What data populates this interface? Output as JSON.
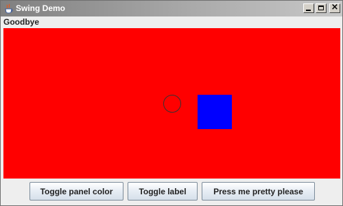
{
  "window": {
    "title": "Swing Demo",
    "controls": {
      "minimize": "minimize-icon",
      "maximize": "maximize-icon",
      "close": "close-icon"
    }
  },
  "label": {
    "text": "Goodbye"
  },
  "panel": {
    "background_color": "#ff0000",
    "circle_stroke": "#333333",
    "square_color": "#0000ff"
  },
  "buttons": [
    {
      "label": "Toggle panel color"
    },
    {
      "label": "Toggle label"
    },
    {
      "label": "Press me pretty please"
    }
  ]
}
